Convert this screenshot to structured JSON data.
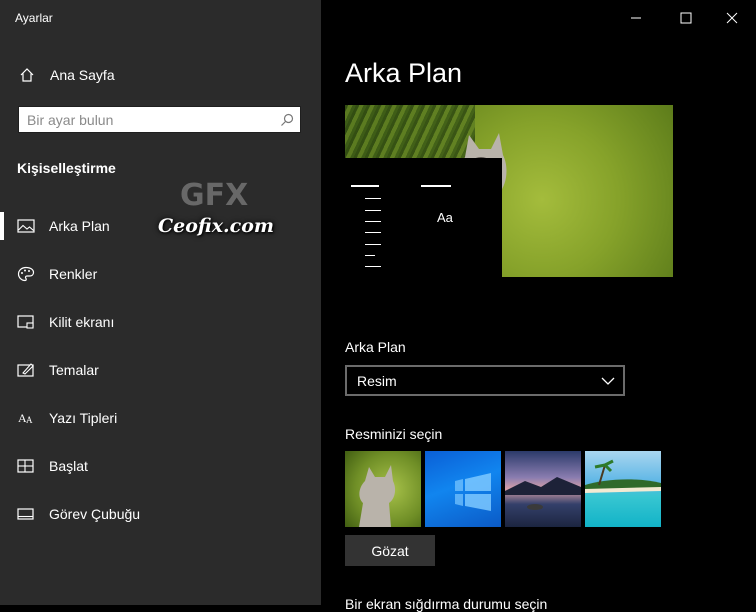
{
  "app": {
    "title": "Ayarlar"
  },
  "sidebar": {
    "home_label": "Ana Sayfa",
    "search_placeholder": "Bir ayar bulun",
    "section_title": "Kişiselleştirme",
    "items": [
      {
        "label": "Arka Plan",
        "icon": "picture-icon",
        "active": true
      },
      {
        "label": "Renkler",
        "icon": "palette-icon",
        "active": false
      },
      {
        "label": "Kilit ekranı",
        "icon": "lock-screen-icon",
        "active": false
      },
      {
        "label": "Temalar",
        "icon": "themes-icon",
        "active": false
      },
      {
        "label": "Yazı Tipleri",
        "icon": "fonts-icon",
        "active": false
      },
      {
        "label": "Başlat",
        "icon": "start-icon",
        "active": false
      },
      {
        "label": "Görev Çubuğu",
        "icon": "taskbar-icon",
        "active": false
      }
    ]
  },
  "watermark": {
    "text": "Ceofix.com",
    "logo_text": "GFX"
  },
  "main": {
    "title": "Arka Plan",
    "preview_sample_text": "Aa",
    "background_label": "Arka Plan",
    "background_value": "Resim",
    "choose_picture_label": "Resminizi seçin",
    "browse_label": "Gözat",
    "fit_label": "Bir ekran sığdırma durumu seçin"
  },
  "colors": {
    "sidebar_bg": "#2b2b2b",
    "main_bg": "#000000",
    "accent": "#ffffff"
  }
}
